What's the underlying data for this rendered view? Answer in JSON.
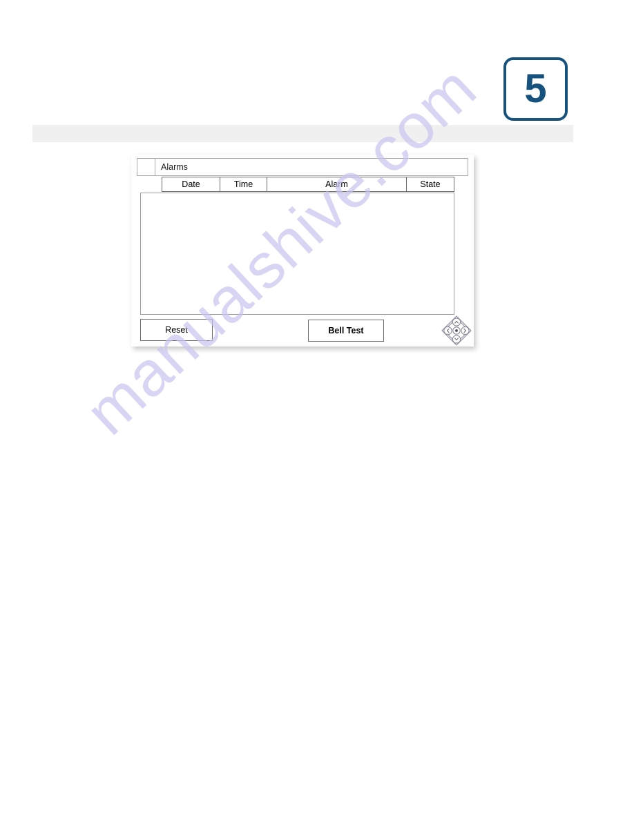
{
  "page": {
    "number": "5"
  },
  "header_band": {
    "text": ""
  },
  "hmi": {
    "tab": {
      "label": "Alarms"
    },
    "table": {
      "columns": [
        {
          "key": "date",
          "label": "Date"
        },
        {
          "key": "time",
          "label": "Time"
        },
        {
          "key": "alarm",
          "label": "Alarm"
        },
        {
          "key": "state",
          "label": "State"
        }
      ],
      "rows": []
    },
    "buttons": {
      "reset": "Reset",
      "bell_test": "Bell Test"
    },
    "nav_pad": {
      "icon": "dpad-navigation-icon",
      "up": "up-arrow",
      "down": "down-arrow",
      "left": "left-arrow",
      "right": "right-arrow",
      "center": "enter"
    }
  },
  "watermark": {
    "text": "manualshive.com",
    "color": "#c9c6ef"
  },
  "colors": {
    "badge_blue": "#17527e",
    "band_gray": "#f0f0f0",
    "border_gray": "#6a6a6a"
  }
}
